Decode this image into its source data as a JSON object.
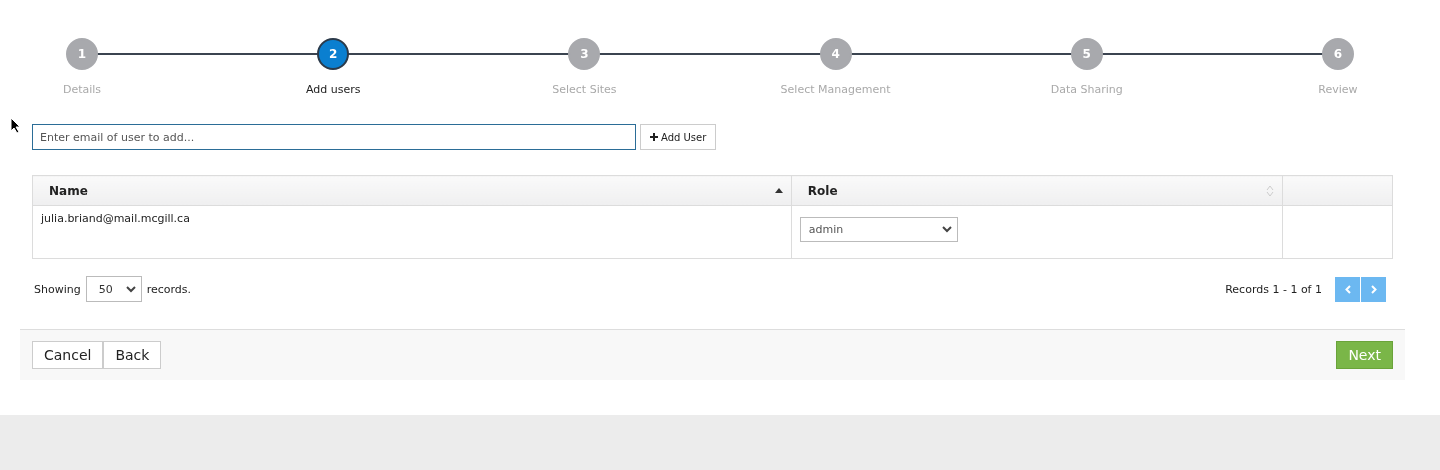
{
  "stepper": [
    {
      "number": "1",
      "label": "Details",
      "selected": false
    },
    {
      "number": "2",
      "label": "Add users",
      "selected": true
    },
    {
      "number": "3",
      "label": "Select Sites",
      "selected": false
    },
    {
      "number": "4",
      "label": "Select Management",
      "selected": false
    },
    {
      "number": "5",
      "label": "Data Sharing",
      "selected": false
    },
    {
      "number": "6",
      "label": "Review",
      "selected": false
    }
  ],
  "email_field": {
    "placeholder": "Enter email of user to add..."
  },
  "add_button": {
    "label": "Add User"
  },
  "table": {
    "columns": [
      {
        "label": "Name",
        "sorted": true
      },
      {
        "label": "Role",
        "sorted": false
      }
    ],
    "rows": [
      {
        "name": "julia.briand@mail.mcgill.ca",
        "role": "admin"
      }
    ]
  },
  "pager": {
    "showing_label": "Showing",
    "page_size": "50",
    "records_label": "records.",
    "summary": "Records 1 - 1 of 1"
  },
  "footer": {
    "buttons": [
      {
        "label": "Cancel",
        "kind": "default"
      },
      {
        "label": "Back",
        "kind": "default"
      },
      {
        "label": "Next",
        "kind": "primary"
      }
    ]
  }
}
